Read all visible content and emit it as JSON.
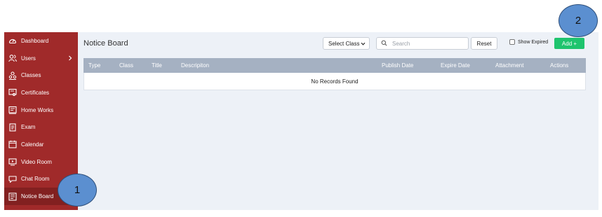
{
  "sidebar": {
    "items": [
      {
        "label": "Dashboard",
        "icon": "dashboard-icon"
      },
      {
        "label": "Users",
        "icon": "users-icon",
        "has_submenu": true
      },
      {
        "label": "Classes",
        "icon": "classes-icon"
      },
      {
        "label": "Certificates",
        "icon": "certificate-icon"
      },
      {
        "label": "Home Works",
        "icon": "homework-icon"
      },
      {
        "label": "Exam",
        "icon": "exam-icon"
      },
      {
        "label": "Calendar",
        "icon": "calendar-icon"
      },
      {
        "label": "Video Room",
        "icon": "video-icon"
      },
      {
        "label": "Chat Room",
        "icon": "chat-icon"
      },
      {
        "label": "Notice Board",
        "icon": "notice-board-icon",
        "active": true
      }
    ]
  },
  "header": {
    "title": "Notice Board",
    "select_class": "Select Class",
    "search_placeholder": "Search",
    "reset_label": "Reset",
    "show_expired_label": "Show Expired",
    "add_label": "Add +"
  },
  "table": {
    "columns": [
      "Type",
      "Class",
      "Title",
      "Descripiton",
      "Publish Date",
      "Expire Date",
      "Attachment",
      "Actions"
    ],
    "empty_message": "No Records Found"
  },
  "annotations": [
    "1",
    "2"
  ],
  "colors": {
    "sidebar": "#a02a2a",
    "sidebar_active": "#822020",
    "main_bg": "#edf1f7",
    "table_header": "#a5b1c2",
    "add_button": "#1fc46e",
    "callout": "#5b8fd0"
  }
}
